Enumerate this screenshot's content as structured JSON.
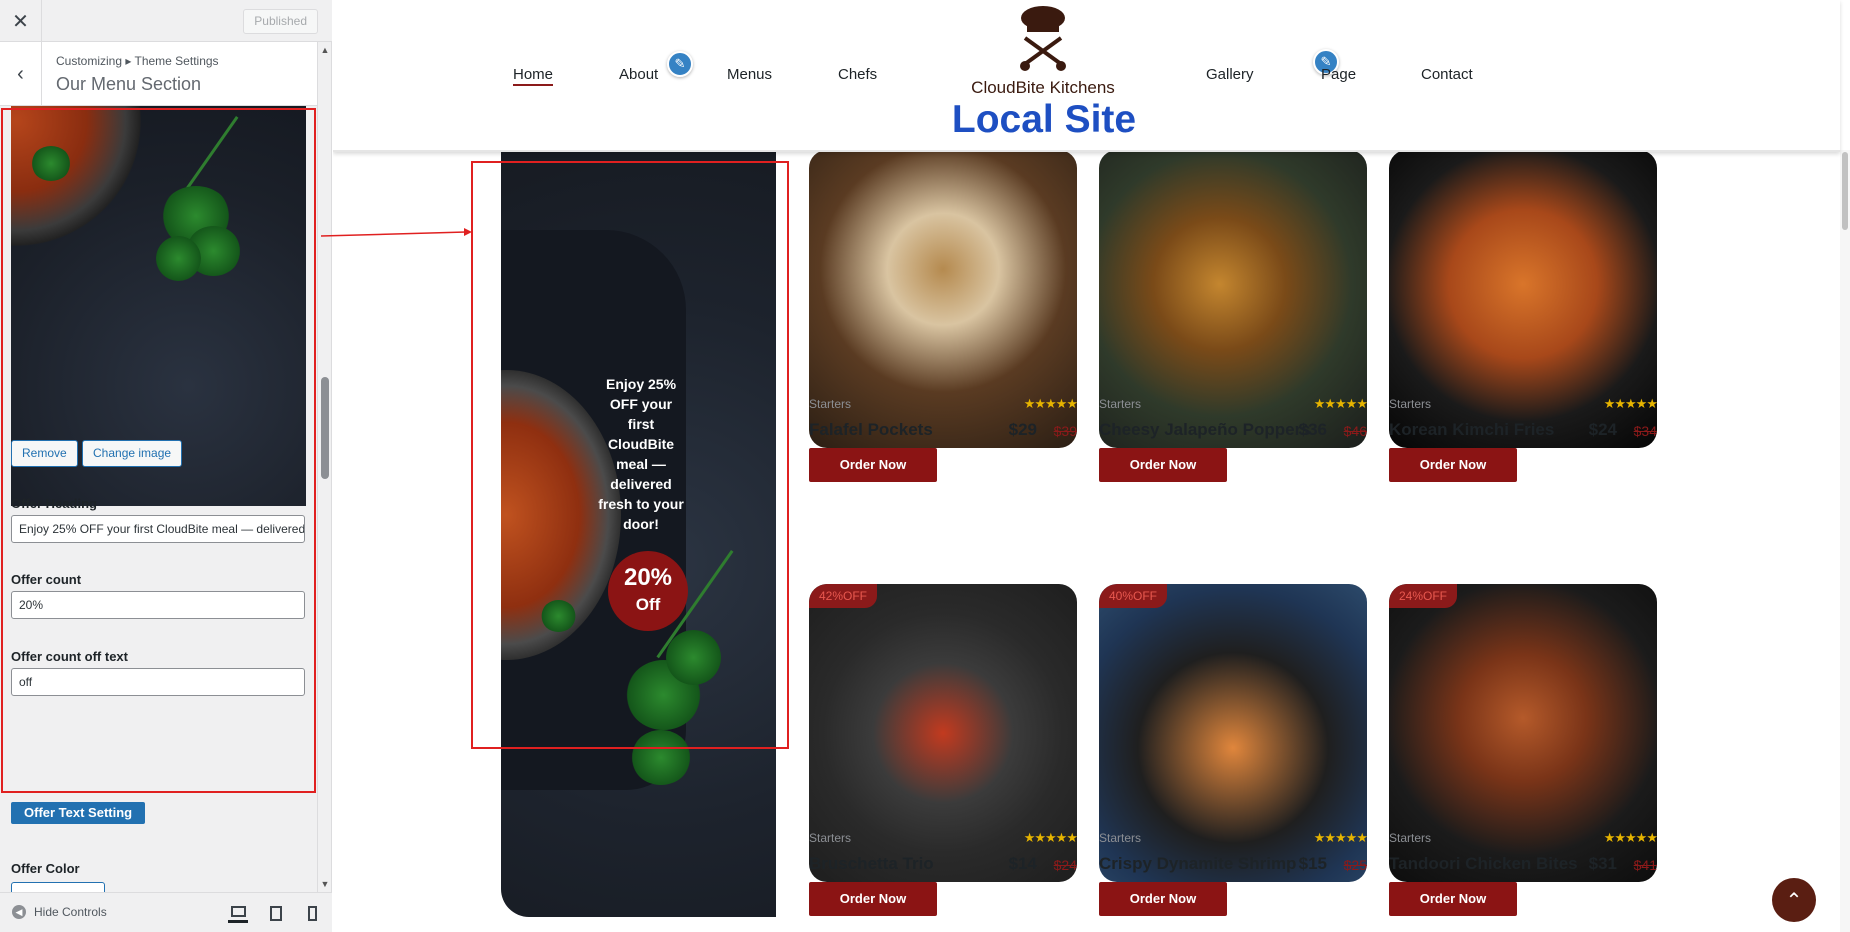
{
  "topbar": {
    "close_label": "✕",
    "published_label": "Published"
  },
  "panel": {
    "breadcrumb": "Customizing ▸ Theme Settings",
    "title": "Our Menu Section",
    "back_label": "‹"
  },
  "image_controls": {
    "remove_label": "Remove",
    "change_label": "Change image"
  },
  "fields": {
    "offer_heading_label": "Offer Heading",
    "offer_heading_value": "Enjoy 25% OFF your first CloudBite meal — delivered fresh to your door!",
    "offer_count_label": "Offer count",
    "offer_count_value": "20%",
    "offer_off_label": "Offer count off text",
    "offer_off_value": "off",
    "offer_text_setting_label": "Offer Text Setting",
    "offer_color_label": "Offer Color"
  },
  "footer": {
    "hide_controls_label": "Hide Controls",
    "devices": [
      "desktop-icon",
      "tablet-icon",
      "mobile-icon"
    ]
  },
  "site": {
    "brand": "CloudBite Kitchens",
    "title": "Local Site",
    "nav": [
      "Home",
      "About",
      "Menus",
      "Chefs",
      "Gallery",
      "Page",
      "Contact"
    ],
    "active_nav": "Home"
  },
  "offer_banner": {
    "heading": "Enjoy 25% OFF your first CloudBite meal — delivered fresh to your door!",
    "count": "20%",
    "off_text": "Off"
  },
  "menu_items": [
    {
      "category": "Starters",
      "rating": 5,
      "stars": "★★★★★",
      "name": "Falafel Pockets",
      "price": "$29",
      "old_price": "$39",
      "discount": "",
      "button": "Order Now"
    },
    {
      "category": "Starters",
      "rating": 5,
      "stars": "★★★★★",
      "name": "Cheesy Jalapeño Poppers",
      "price": "$36",
      "old_price": "$46",
      "discount": "",
      "button": "Order Now"
    },
    {
      "category": "Starters",
      "rating": 5,
      "stars": "★★★★★",
      "name": "Korean Kimchi Fries",
      "price": "$24",
      "old_price": "$34",
      "discount": "",
      "button": "Order Now"
    },
    {
      "category": "Starters",
      "rating": 5,
      "stars": "★★★★★",
      "name": "Bruschetta Trio",
      "price": "$14",
      "old_price": "$24",
      "discount": "42%OFF",
      "button": "Order Now"
    },
    {
      "category": "Starters",
      "rating": 5,
      "stars": "★★★★★",
      "name": "Crispy Dynamite Shrimp",
      "price": "$15",
      "old_price": "$25",
      "discount": "40%OFF",
      "button": "Order Now"
    },
    {
      "category": "Starters",
      "rating": 5,
      "stars": "★★★★★",
      "name": "Tandoori Chicken Bites",
      "price": "$31",
      "old_price": "$41",
      "discount": "24%OFF",
      "button": "Order Now"
    }
  ],
  "colors": {
    "brand_red": "#8b1414",
    "accent_blue": "#1e4fc2",
    "wp_blue": "#2271b1",
    "highlight": "#e02020"
  },
  "back_to_top_icon": "double-chevron-up-icon"
}
